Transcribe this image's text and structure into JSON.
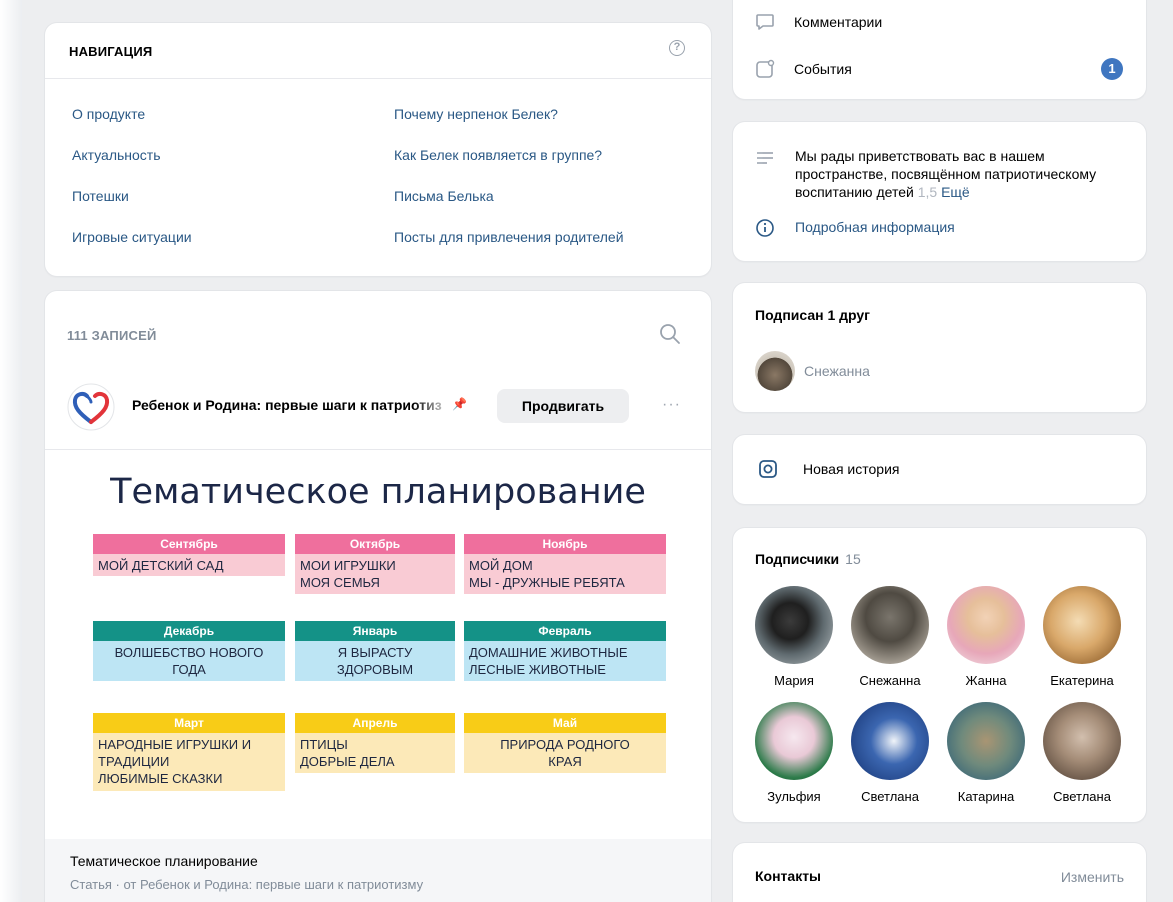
{
  "navigation": {
    "title": "НАВИГАЦИЯ",
    "links_left": [
      "О продукте",
      "Актуальность",
      "Потешки",
      "Игровые ситуации"
    ],
    "links_right": [
      "Почему нерпенок Белек?",
      "Как Белек появляется в группе?",
      "Письма Белька",
      "Посты для привлечения родителей"
    ]
  },
  "wall": {
    "posts_count": "111 ЗАПИСЕЙ",
    "post": {
      "author": "Ребенок и Родина: первые шаги к патриотизму",
      "promote_label": "Продвигать",
      "more": "···",
      "image": {
        "title": "Тематическое планирование",
        "months": [
          {
            "name": "Сентябрь",
            "topics": [
              "Мой детский сад"
            ]
          },
          {
            "name": "Октябрь",
            "topics": [
              "Мои игрушки",
              "Моя семья"
            ]
          },
          {
            "name": "Ноябрь",
            "topics": [
              "Мой дом",
              "Мы - дружные ребята"
            ]
          },
          {
            "name": "Декабрь",
            "topics": [
              "Волшебство нового",
              "года"
            ]
          },
          {
            "name": "Январь",
            "topics": [
              "Я вырасту",
              "здоровым"
            ]
          },
          {
            "name": "Февраль",
            "topics": [
              "Домашние животные",
              "Лесные животные"
            ]
          },
          {
            "name": "Март",
            "topics": [
              "Народные игрушки и",
              "традиции",
              "Любимые сказки"
            ]
          },
          {
            "name": "Апрель",
            "topics": [
              "Птицы",
              "Добрые дела"
            ]
          },
          {
            "name": "Май",
            "topics": [
              "Природа родного",
              "края"
            ]
          }
        ]
      },
      "article_title": "Тематическое планирование",
      "article_sub": "Статья · от Ребенок и Родина: первые шаги к патриотизму"
    }
  },
  "sidebar": {
    "comments_label": "Комментарии",
    "events_label": "События",
    "events_badge": "1",
    "description_text": "Мы рады приветствовать вас в нашем пространстве, посвящённом патриотическому воспитанию детей",
    "description_dim": "1,5",
    "description_more": "Ещё",
    "info_link": "Подробная информация",
    "friends_title": "Подписан 1 друг",
    "friend_name": "Снежанна",
    "story_label": "Новая история",
    "subscribers_title": "Подписчики",
    "subscribers_count": "15",
    "subscribers": [
      "Мария",
      "Снежанна",
      "Жанна",
      "Екатерина",
      "Зульфия",
      "Светлана",
      "Катарина",
      "Светлана"
    ],
    "contacts_title": "Контакты",
    "contacts_edit": "Изменить"
  },
  "colors": {
    "link": "#2a5885",
    "badge": "#3f76c0",
    "month_pink": "#ef6f9d",
    "month_teal": "#149287",
    "month_yellow": "#f8cc17"
  }
}
